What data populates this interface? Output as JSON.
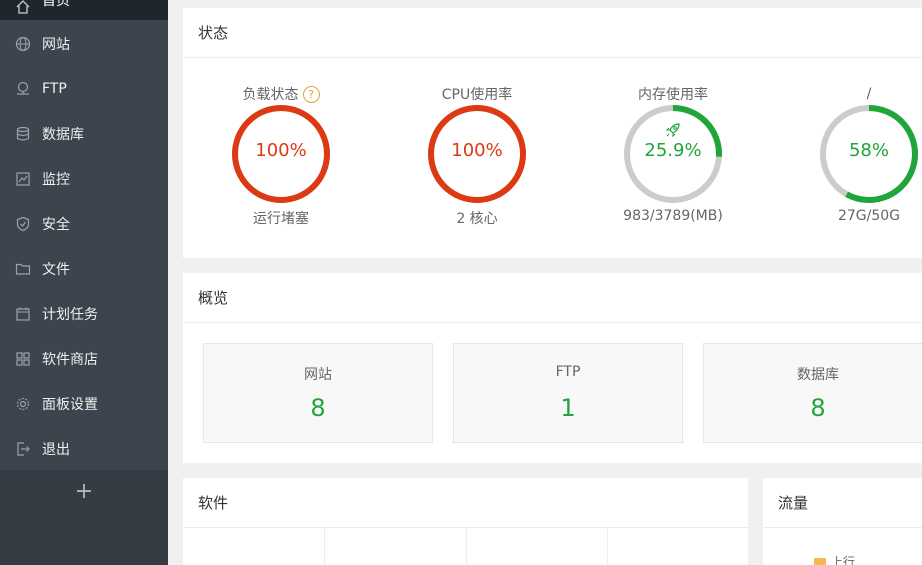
{
  "sidebar": {
    "active_label": "首页",
    "items": [
      {
        "key": "website",
        "label": "网站",
        "icon": "globe-icon"
      },
      {
        "key": "ftp",
        "label": "FTP",
        "icon": "ftp-icon"
      },
      {
        "key": "database",
        "label": "数据库",
        "icon": "database-icon"
      },
      {
        "key": "monitor",
        "label": "监控",
        "icon": "monitor-icon"
      },
      {
        "key": "security",
        "label": "安全",
        "icon": "shield-icon"
      },
      {
        "key": "files",
        "label": "文件",
        "icon": "folder-icon"
      },
      {
        "key": "cron",
        "label": "计划任务",
        "icon": "calendar-icon"
      },
      {
        "key": "store",
        "label": "软件商店",
        "icon": "apps-icon"
      },
      {
        "key": "settings",
        "label": "面板设置",
        "icon": "gear-icon"
      },
      {
        "key": "logout",
        "label": "退出",
        "icon": "logout-icon"
      }
    ],
    "add_label": "+"
  },
  "status": {
    "title": "状态",
    "gauges": [
      {
        "label": "负载状态",
        "value": "100%",
        "percent": 1.0,
        "sub": "运行堵塞",
        "color": "#dd3a13",
        "help": "?"
      },
      {
        "label": "CPU使用率",
        "value": "100%",
        "percent": 1.0,
        "sub": "2 核心",
        "color": "#dd3a13"
      },
      {
        "label": "内存使用率",
        "value": "25.9%",
        "percent": 0.259,
        "sub": "983/3789(MB)",
        "color": "#20a53a",
        "icon": "rocket-icon"
      },
      {
        "label": "/",
        "value": "58%",
        "percent": 0.58,
        "sub": "27G/50G",
        "color": "#20a53a"
      }
    ]
  },
  "overview": {
    "title": "概览",
    "cards": [
      {
        "label": "网站",
        "value": "8"
      },
      {
        "label": "FTP",
        "value": "1"
      },
      {
        "label": "数据库",
        "value": "8"
      }
    ]
  },
  "software": {
    "title": "软件"
  },
  "traffic": {
    "title": "流量",
    "legend_up": "上行"
  },
  "colors": {
    "sidebar_bg": "#3c444d",
    "sidebar_active": "#20272c",
    "danger": "#dd3a13",
    "success": "#20a53a",
    "track": "#cccccc"
  }
}
